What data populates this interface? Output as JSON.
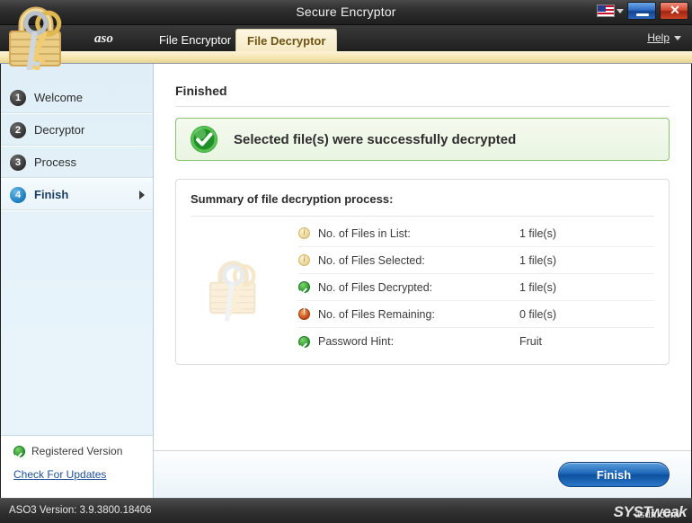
{
  "window": {
    "title": "Secure Encryptor",
    "language_icon": "us-flag-icon",
    "minimize_label": "",
    "close_label": "✕"
  },
  "tabbar": {
    "brand": "aso",
    "tabs": [
      {
        "label": "File Encryptor",
        "active": false
      },
      {
        "label": "File Decryptor",
        "active": true
      }
    ],
    "help_label": "Help"
  },
  "sidebar": {
    "steps": [
      {
        "number": "1",
        "label": "Welcome",
        "active": false
      },
      {
        "number": "2",
        "label": "Decryptor",
        "active": false
      },
      {
        "number": "3",
        "label": "Process",
        "active": false
      },
      {
        "number": "4",
        "label": "Finish",
        "active": true
      }
    ],
    "registered_label": "Registered Version",
    "update_link": "Check For Updates"
  },
  "content": {
    "page_title": "Finished",
    "success_message": "Selected file(s) were successfully decrypted",
    "summary_title": "Summary of file decryption process:",
    "summary_rows": [
      {
        "icon": "info-icon",
        "label": "No. of Files in List:",
        "value": "1 file(s)"
      },
      {
        "icon": "info-icon",
        "label": "No. of Files Selected:",
        "value": "1 file(s)"
      },
      {
        "icon": "success-icon",
        "label": "No. of Files Decrypted:",
        "value": "1 file(s)"
      },
      {
        "icon": "warning-icon",
        "label": "No. of Files Remaining:",
        "value": "0 file(s)"
      },
      {
        "icon": "success-icon",
        "label": "Password Hint:",
        "value": "Fruit"
      }
    ]
  },
  "actionbar": {
    "finish_label": "Finish"
  },
  "statusbar": {
    "version_text": "ASO3 Version: 3.9.3800.18406",
    "watermark": "SYSTweak",
    "watermark_overlay": "asdn.com"
  },
  "colors": {
    "accent_blue": "#1b62b5",
    "success_green": "#1f8f27",
    "warning_orange": "#c2410c",
    "info_amber": "#d4b86a",
    "tab_active_bg": "#fdf6e2",
    "sidebar_bg": "#e6f2f9"
  }
}
